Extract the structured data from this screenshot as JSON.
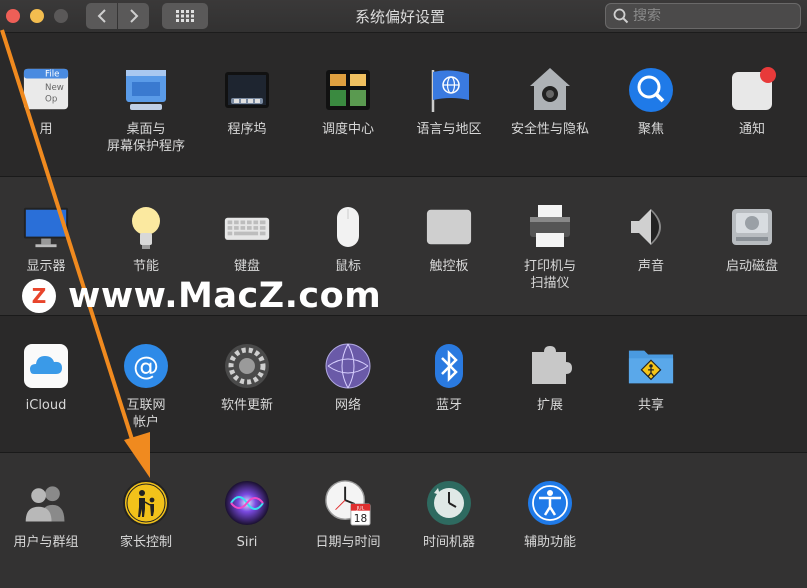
{
  "window": {
    "title": "系统偏好设置",
    "search_placeholder": "搜索"
  },
  "panes": {
    "row1": [
      {
        "label": "通用",
        "visible_label": "用",
        "icon": "general-icon"
      },
      {
        "label": "桌面与\n屏幕保护程序",
        "icon": "desktop-screensaver-icon"
      },
      {
        "label": "程序坞",
        "icon": "dock-icon"
      },
      {
        "label": "调度中心",
        "icon": "mission-control-icon"
      },
      {
        "label": "语言与地区",
        "icon": "language-region-icon"
      },
      {
        "label": "安全性与隐私",
        "icon": "security-privacy-icon"
      },
      {
        "label": "聚焦",
        "icon": "spotlight-icon"
      },
      {
        "label": "通知",
        "icon": "notifications-icon"
      }
    ],
    "row2": [
      {
        "label": "显示器",
        "icon": "displays-icon"
      },
      {
        "label": "节能",
        "icon": "energy-saver-icon"
      },
      {
        "label": "键盘",
        "icon": "keyboard-icon"
      },
      {
        "label": "鼠标",
        "icon": "mouse-icon"
      },
      {
        "label": "触控板",
        "icon": "trackpad-icon"
      },
      {
        "label": "打印机与\n扫描仪",
        "icon": "printers-scanners-icon"
      },
      {
        "label": "声音",
        "icon": "sound-icon"
      },
      {
        "label": "启动磁盘",
        "icon": "startup-disk-icon"
      }
    ],
    "row3": [
      {
        "label": "iCloud",
        "icon": "icloud-icon"
      },
      {
        "label": "互联网\n帐户",
        "icon": "internet-accounts-icon"
      },
      {
        "label": "软件更新",
        "icon": "software-update-icon"
      },
      {
        "label": "网络",
        "icon": "network-icon"
      },
      {
        "label": "蓝牙",
        "icon": "bluetooth-icon"
      },
      {
        "label": "扩展",
        "icon": "extensions-icon"
      },
      {
        "label": "共享",
        "icon": "sharing-icon"
      }
    ],
    "row4": [
      {
        "label": "用户与群组",
        "icon": "users-groups-icon"
      },
      {
        "label": "家长控制",
        "icon": "parental-controls-icon"
      },
      {
        "label": "Siri",
        "icon": "siri-icon"
      },
      {
        "label": "日期与时间",
        "icon": "date-time-icon"
      },
      {
        "label": "时间机器",
        "icon": "time-machine-icon"
      },
      {
        "label": "辅助功能",
        "icon": "accessibility-icon"
      }
    ]
  },
  "calendar_icon": {
    "month": "JUL",
    "day": "18"
  },
  "watermark": {
    "logo_letter": "Z",
    "text": "www.MacZ.com"
  },
  "colors": {
    "accent_arrow": "#f08a1f",
    "background": "#2a2929"
  }
}
